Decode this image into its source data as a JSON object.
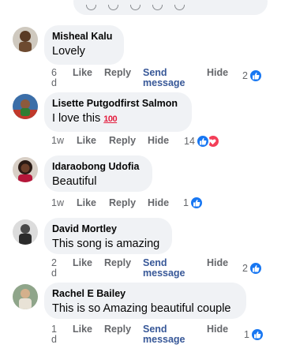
{
  "comments": [
    {
      "author": "Misheal Kalu",
      "text": "Lovely",
      "time": "6 d",
      "like": "Like",
      "reply": "Reply",
      "send": "Send message",
      "hide": "Hide",
      "reaction_count": "2",
      "reactions": [
        "like-icon"
      ]
    },
    {
      "author": "Lisette Putgodfirst Salmon",
      "text": "I love this",
      "emoji": "100",
      "time": "1w",
      "like": "Like",
      "reply": "Reply",
      "hide": "Hide",
      "reaction_count": "14",
      "reactions": [
        "like-icon",
        "love-icon"
      ]
    },
    {
      "author": "Idaraobong Udofia",
      "text": "Beautiful",
      "time": "1w",
      "like": "Like",
      "reply": "Reply",
      "hide": "Hide",
      "reaction_count": "1",
      "reactions": [
        "like-icon"
      ]
    },
    {
      "author": "David Mortley",
      "text": "This song is amazing",
      "time": "2 d",
      "like": "Like",
      "reply": "Reply",
      "send": "Send message",
      "hide": "Hide",
      "reaction_count": "2",
      "reactions": [
        "like-icon"
      ]
    },
    {
      "author": "Rachel E Bailey",
      "text": "This is so Amazing beautiful couple",
      "time": "1 d",
      "like": "Like",
      "reply": "Reply",
      "send": "Send message",
      "hide": "Hide",
      "reaction_count": "1",
      "reactions": [
        "like-icon"
      ]
    }
  ],
  "colors": {
    "bubble": "#f0f2f5",
    "action_text": "#65676b",
    "link": "#385898",
    "like_blue": "#1877f2",
    "love_red": "#f33e58"
  }
}
